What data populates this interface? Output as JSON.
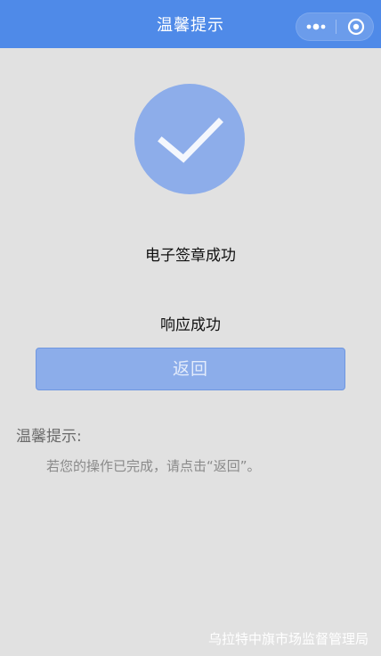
{
  "navbar": {
    "title": "温馨提示",
    "background": "#4f8ae8",
    "capsule": {
      "more_icon": "more-dots-icon",
      "close_icon": "circle-close-icon"
    }
  },
  "status": {
    "icon": "checkmark-icon",
    "icon_color": "#8dadea",
    "sign_result": "电子签章成功",
    "response_result": "响应成功"
  },
  "actions": {
    "return_label": "返回"
  },
  "tips": {
    "title": "温馨提示:",
    "body": "若您的操作已完成，请点击“返回”。"
  },
  "footer": {
    "organization": "乌拉特中旗市场监督管理局"
  }
}
